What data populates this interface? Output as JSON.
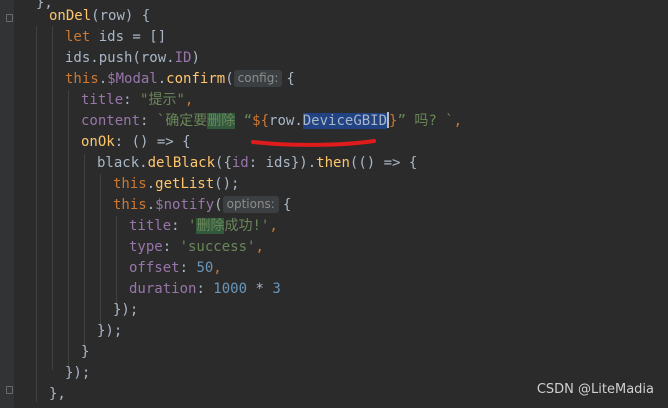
{
  "editor": {
    "lines": {
      "l0": {
        "a": "},"
      },
      "l1": {
        "a": "onDel",
        "b": "(row) {"
      },
      "l2": {
        "a": "let ",
        "b": "ids = []"
      },
      "l3": {
        "a": "ids.push(row.",
        "b": "ID",
        ")": ")"
      },
      "l4": {
        "a": "this",
        "b": ".",
        "c": "$Modal",
        "d": ".",
        "e": "confirm",
        "f": "(",
        "hint": "config:",
        "g": "{"
      },
      "l5": {
        "a": "title",
        "b": ": ",
        "c": "\"提示\"",
        ",": ","
      },
      "l6": {
        "a": "content",
        "b": ": ",
        "c": "`确定要",
        "d": "删除",
        " e": " “",
        "f": "${",
        "g": "row.",
        "h": "DeviceGBID",
        "i": "}",
        "j": "” 吗? `",
        ",": ","
      },
      "l7": {
        "a": "onOk",
        "b": ": () => {"
      },
      "l8": {
        "a": "black.",
        "b": "delBlack",
        "c": "({",
        "d": "id",
        "e": ": ids}).",
        "f": "then",
        "g": "(() => {"
      },
      "l9": {
        "a": "this",
        "b": ".",
        "c": "getList",
        "d": "();"
      },
      "l10": {
        "a": "this",
        "b": ".",
        "c": "$notify",
        "d": "(",
        "hint": "options:",
        "e": "{"
      },
      "l11": {
        "a": "title",
        "b": ": ",
        "c": "'",
        "d": "删除",
        "e": "成功!'",
        ",": ","
      },
      "l12": {
        "a": "type",
        "b": ": ",
        "c": "'success'",
        ",": ","
      },
      "l13": {
        "a": "offset",
        "b": ": ",
        "c": "50",
        ",": ","
      },
      "l14": {
        "a": "duration",
        "b": ": ",
        "c": "1000",
        " d": " * ",
        "e": "3"
      },
      "l15": {
        "a": "});"
      },
      "l16": {
        "a": "});"
      },
      "l17": {
        "a": "}"
      },
      "l18": {
        "a": "});"
      },
      "l19": {
        "a": "},"
      }
    }
  },
  "watermark": "CSDN @LiteMadia",
  "colors": {
    "background": "#2b2b2b",
    "keyword": "#cc7832",
    "function": "#ffc66d",
    "property": "#9876aa",
    "string": "#6a8759",
    "number": "#6897bb",
    "selection": "#214283",
    "annotation": "#e01b1b"
  }
}
